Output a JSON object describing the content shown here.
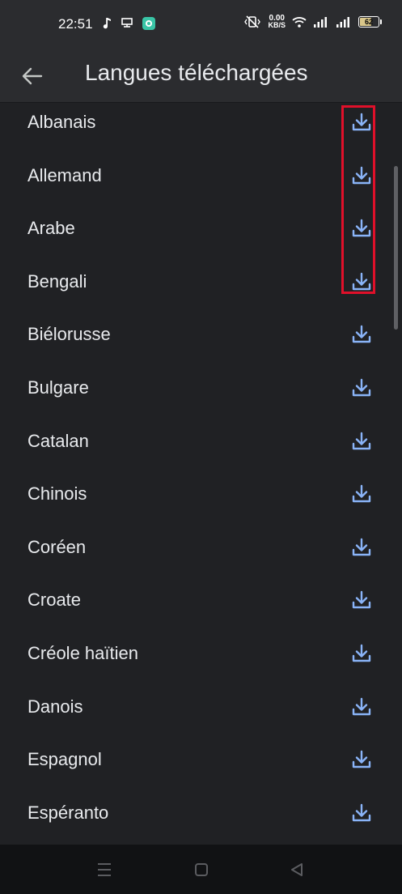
{
  "status_bar": {
    "time": "22:51",
    "net_speed_value": "0.00",
    "net_speed_unit": "KB/S",
    "battery_level": "62",
    "battery_fill_fraction": 0.62
  },
  "header": {
    "title": "Langues téléchargées"
  },
  "colors": {
    "accent": "#8ab4f8",
    "highlight": "#e0102a",
    "background": "#202124"
  },
  "languages": [
    {
      "label": "Albanais",
      "icon": "download-icon"
    },
    {
      "label": "Allemand",
      "icon": "download-icon"
    },
    {
      "label": "Arabe",
      "icon": "download-icon"
    },
    {
      "label": "Bengali",
      "icon": "download-icon"
    },
    {
      "label": "Biélorusse",
      "icon": "download-icon"
    },
    {
      "label": "Bulgare",
      "icon": "download-icon"
    },
    {
      "label": "Catalan",
      "icon": "download-icon"
    },
    {
      "label": "Chinois",
      "icon": "download-icon"
    },
    {
      "label": "Coréen",
      "icon": "download-icon"
    },
    {
      "label": "Croate",
      "icon": "download-icon"
    },
    {
      "label": "Créole haïtien",
      "icon": "download-icon"
    },
    {
      "label": "Danois",
      "icon": "download-icon"
    },
    {
      "label": "Espagnol",
      "icon": "download-icon"
    },
    {
      "label": "Espéranto",
      "icon": "download-icon"
    }
  ]
}
